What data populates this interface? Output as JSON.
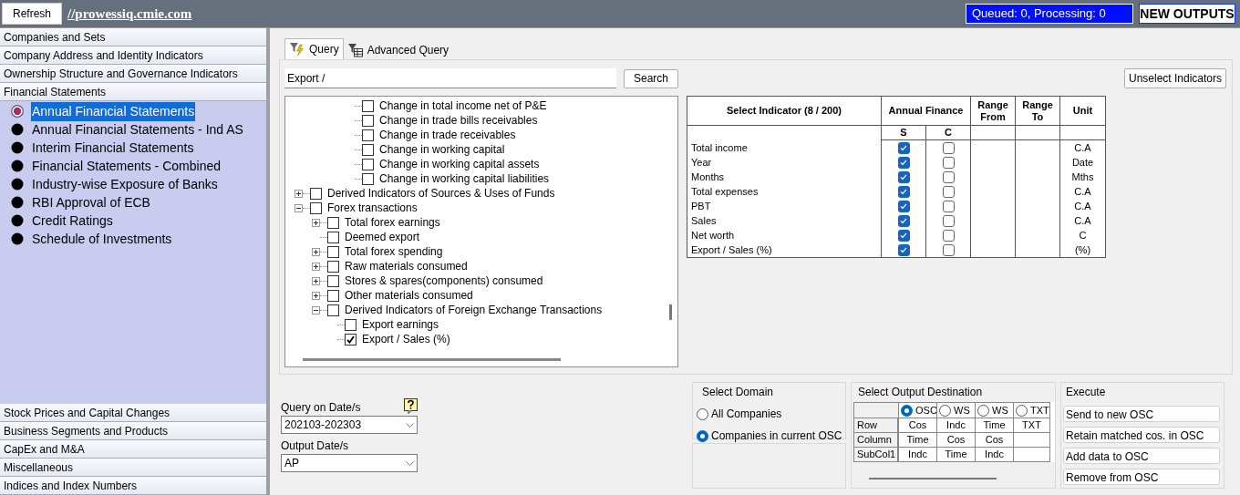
{
  "toolbar": {
    "refresh": "Refresh",
    "url": "//prowessiq.cmie.com",
    "queue_status": "Queued: 0, Processing: 0",
    "new_outputs": "NEW OUTPUTS"
  },
  "sidebar": {
    "top_sections": [
      "Companies and Sets",
      "Company Address and Identity Indicators",
      "Ownership Structure and Governance Indicators",
      "Financial Statements"
    ],
    "items": [
      {
        "label": "Annual Financial Statements",
        "selected": true
      },
      {
        "label": "Annual Financial Statements - Ind AS",
        "selected": false
      },
      {
        "label": "Interim Financial Statements",
        "selected": false
      },
      {
        "label": "Financial Statements - Combined",
        "selected": false
      },
      {
        "label": "Industry-wise Exposure of Banks",
        "selected": false
      },
      {
        "label": "RBI Approval of ECB",
        "selected": false
      },
      {
        "label": "Credit Ratings",
        "selected": false
      },
      {
        "label": "Schedule of Investments",
        "selected": false
      }
    ],
    "bottom_sections": [
      "Stock Prices and Capital Changes",
      "Business Segments and Products",
      "CapEx and M&A",
      "Miscellaneous",
      "Indices and Index Numbers"
    ]
  },
  "tabs": [
    {
      "label": "Query",
      "kind": "query",
      "selected": true
    },
    {
      "label": "Advanced Query",
      "kind": "advanced",
      "selected": false
    }
  ],
  "search": {
    "value": "Export /",
    "button": "Search"
  },
  "unselect_button": "Unselect Indicators",
  "tree": [
    {
      "children": [
        {
          "children": [
            {
              "children": [
                {
                  "label": "Change in total income net of P&E",
                  "checked": false
                },
                {
                  "label": "Change in trade bills receivables",
                  "checked": false
                },
                {
                  "label": "Change in trade receivables",
                  "checked": false
                },
                {
                  "label": "Change in working capital",
                  "checked": false
                },
                {
                  "label": "Change in working capital assets",
                  "checked": false
                },
                {
                  "label": "Change in working capital liabilities",
                  "checked": false
                }
              ]
            }
          ]
        }
      ]
    },
    {
      "label": "Derived Indicators of Sources & Uses of Funds",
      "checked": false,
      "expanded": false
    },
    {
      "label": "Forex transactions",
      "checked": false,
      "expanded": true,
      "children": [
        {
          "label": "Total forex earnings",
          "checked": false,
          "expanded": false
        },
        {
          "label": "Deemed export",
          "checked": false
        },
        {
          "label": "Total forex spending",
          "checked": false,
          "expanded": false
        },
        {
          "label": "Raw materials consumed",
          "checked": false,
          "expanded": false
        },
        {
          "label": "Stores & spares(components) consumed",
          "checked": false,
          "expanded": false
        },
        {
          "label": "Other materials consumed",
          "checked": false,
          "expanded": false
        },
        {
          "label": "Derived Indicators of Foreign Exchange Transactions",
          "checked": false,
          "expanded": true,
          "children": [
            {
              "label": "Export earnings",
              "checked": false
            },
            {
              "label": "Export / Sales (%)",
              "checked": true
            }
          ]
        }
      ]
    }
  ],
  "indicator_table": {
    "columns": [
      "Select Indicator (8 / 200)",
      "Annual Finance",
      "Range From",
      "Range To",
      "Unit"
    ],
    "subcolumns": [
      "S",
      "C"
    ],
    "rows": [
      {
        "name": "Total income",
        "s": true,
        "c": false,
        "unit": "C.A"
      },
      {
        "name": "Year",
        "s": true,
        "c": false,
        "unit": "Date"
      },
      {
        "name": "Months",
        "s": true,
        "c": false,
        "unit": "Mths"
      },
      {
        "name": "Total expenses",
        "s": true,
        "c": false,
        "unit": "C.A"
      },
      {
        "name": "PBT",
        "s": true,
        "c": false,
        "unit": "C.A"
      },
      {
        "name": "Sales",
        "s": true,
        "c": false,
        "unit": "C.A"
      },
      {
        "name": "Net worth",
        "s": true,
        "c": false,
        "unit": "C"
      },
      {
        "name": "Export / Sales (%)",
        "s": true,
        "c": false,
        "unit": "(%)"
      }
    ]
  },
  "query_dates": {
    "label": "Query on Date/s",
    "value": "202103-202303"
  },
  "output_dates": {
    "label": "Output Date/s",
    "value": "AP"
  },
  "domain": {
    "title": "Select Domain",
    "options": [
      {
        "label": "All Companies",
        "selected": false
      },
      {
        "label": "Companies in current OSC",
        "selected": true
      }
    ]
  },
  "destination": {
    "title": "Select Output Destination",
    "options": [
      {
        "label": "OSC",
        "selected": true
      },
      {
        "label": "WS",
        "selected": false
      },
      {
        "label": "WS",
        "selected": false
      },
      {
        "label": "TXT",
        "selected": false
      }
    ],
    "rows": [
      {
        "label": "Row",
        "cells": [
          "Cos",
          "Indc",
          "Time",
          "TXT"
        ]
      },
      {
        "label": "Column",
        "cells": [
          "Time",
          "Cos",
          "Cos",
          ""
        ]
      },
      {
        "label": "SubCol1",
        "cells": [
          "Indc",
          "Time",
          "Indc",
          ""
        ]
      }
    ]
  },
  "execute": {
    "title": "Execute",
    "buttons": [
      "Send to new OSC",
      "Retain matched cos. in OSC",
      "Add data to OSC",
      "Remove from OSC"
    ]
  }
}
